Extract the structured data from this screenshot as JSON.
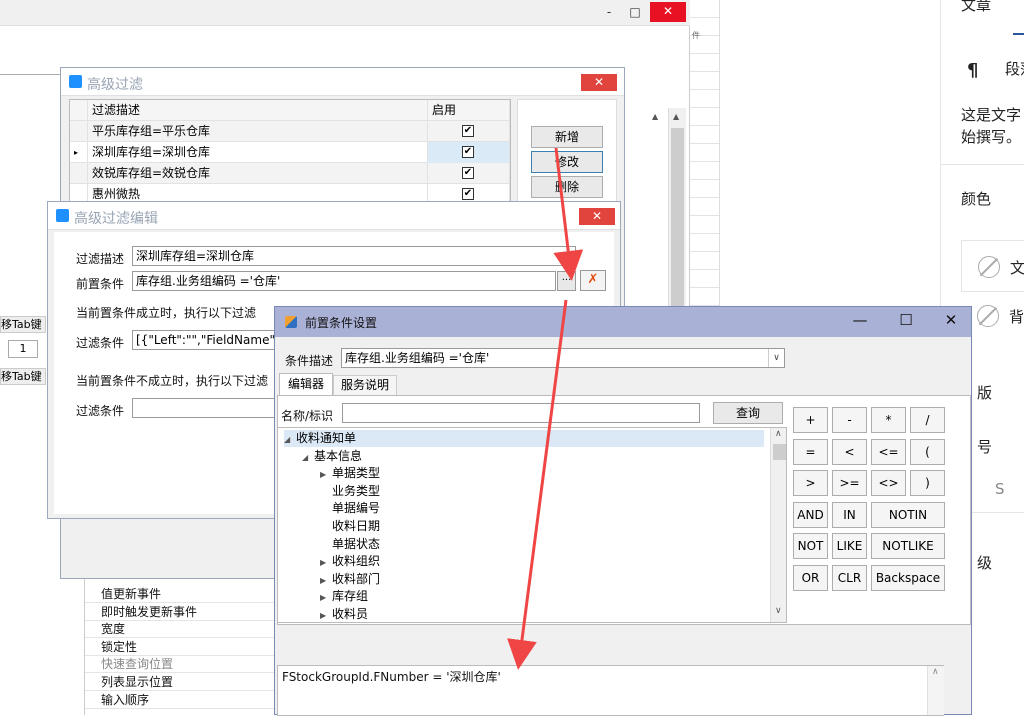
{
  "background_window": {
    "minimize": "-",
    "maximize": "□",
    "close": "✕",
    "side_label_1": "移Tab键",
    "side_value": "1",
    "side_label_2": "移Tab键",
    "grid_strip_label": "件"
  },
  "background_list": {
    "items": [
      "值更新事件",
      "即时触发更新事件",
      "宽度",
      "锁定性",
      "快速查询位置",
      "列表显示位置",
      "输入顺序"
    ]
  },
  "right_panel": {
    "tab_label": "文章",
    "paragraph_label": "段落",
    "paragraph_icon": "¶",
    "hint_text_1": "这是文字",
    "hint_text_2": "始撰写。",
    "color_heading": "颜色",
    "text_color_label": "文",
    "bg_color_label": "背",
    "layout_label": "版",
    "size_label": "号",
    "size_value": "S",
    "level_label": "级"
  },
  "filter_dialog": {
    "title": "高级过滤",
    "close": "✕",
    "columns": [
      "过滤描述",
      "启用"
    ],
    "rows": [
      {
        "desc": "平乐库存组=平乐仓库",
        "enabled": true,
        "selected": false
      },
      {
        "desc": "深圳库存组=深圳仓库",
        "enabled": true,
        "selected": true
      },
      {
        "desc": "效锐库存组=效锐仓库",
        "enabled": true,
        "selected": false
      },
      {
        "desc": "惠州微热",
        "enabled": true,
        "selected": false
      }
    ],
    "buttons": {
      "add": "新增",
      "edit": "修改",
      "delete": "删除"
    }
  },
  "edit_dialog": {
    "title": "高级过滤编辑",
    "close": "✕",
    "filter_desc_label": "过滤描述",
    "filter_desc_value": "深圳库存组=深圳仓库",
    "precondition_label": "前置条件",
    "precondition_value": "库存组.业务组编码  ='仓库'",
    "browse_button": "···",
    "when_true_label": "当前置条件成立时，执行以下过滤",
    "filter_cond_label": "过滤条件",
    "filter_cond_value": "[{\"Left\":\"\",\"FieldName\":\"F",
    "when_false_label": "当前置条件不成立时，执行以下过滤",
    "filter_cond2_label": "过滤条件",
    "filter_cond2_value": ""
  },
  "precondition_dialog": {
    "title": "前置条件设置",
    "minimize": "—",
    "maximize": "☐",
    "close": "✕",
    "cond_desc_label": "条件描述",
    "cond_desc_value": "库存组.业务组编码  ='仓库'",
    "tabs": [
      "编辑器",
      "服务说明"
    ],
    "name_label": "名称/标识",
    "name_value": "",
    "query_button": "查询",
    "tree": [
      {
        "label": "收料通知单",
        "level": 0,
        "arrow": "expanded"
      },
      {
        "label": "基本信息",
        "level": 1,
        "arrow": "expanded"
      },
      {
        "label": "单据类型",
        "level": 2,
        "arrow": "collapsed"
      },
      {
        "label": "业务类型",
        "level": 2,
        "arrow": "none"
      },
      {
        "label": "单据编号",
        "level": 2,
        "arrow": "none"
      },
      {
        "label": "收料日期",
        "level": 2,
        "arrow": "none"
      },
      {
        "label": "单据状态",
        "level": 2,
        "arrow": "none"
      },
      {
        "label": "收料组织",
        "level": 2,
        "arrow": "collapsed"
      },
      {
        "label": "收料部门",
        "level": 2,
        "arrow": "collapsed"
      },
      {
        "label": "库存组",
        "level": 2,
        "arrow": "collapsed"
      },
      {
        "label": "收料员",
        "level": 2,
        "arrow": "collapsed"
      }
    ],
    "operators": [
      [
        "+",
        "-",
        "*",
        "/"
      ],
      [
        "=",
        "<",
        "<=",
        "("
      ],
      [
        ">",
        ">=",
        "<>",
        ")"
      ],
      [
        "AND",
        "IN",
        "NOTIN"
      ],
      [
        "NOT",
        "LIKE",
        "NOTLIKE"
      ],
      [
        "OR",
        "CLR",
        "Backspace"
      ]
    ],
    "expression": "FStockGroupId.FNumber  = '深圳仓库'"
  },
  "annotation_color": "#f04545"
}
